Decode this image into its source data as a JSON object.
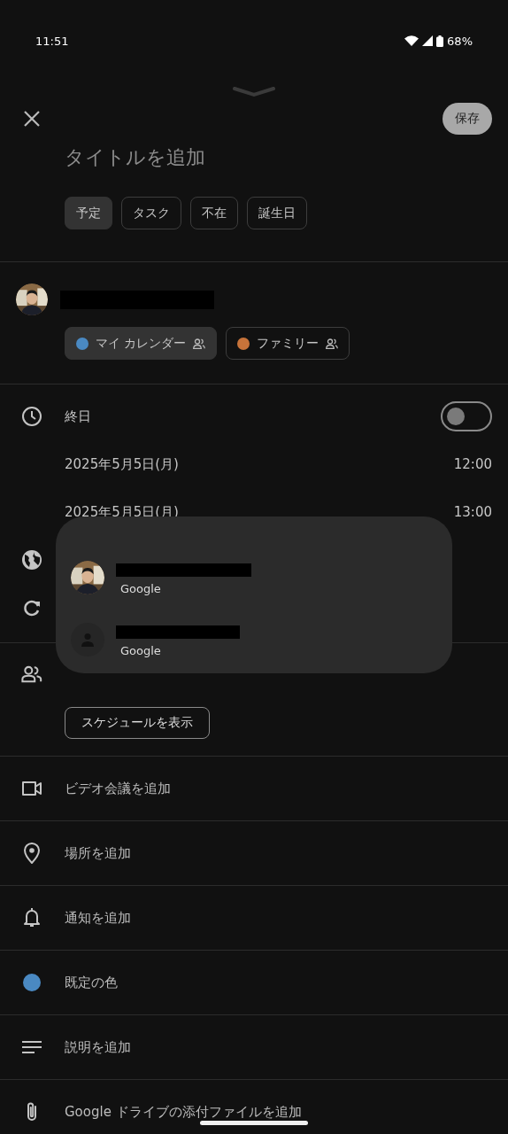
{
  "status_bar": {
    "time": "11:51",
    "battery": "68%"
  },
  "header": {
    "save": "保存"
  },
  "title": {
    "placeholder": "タイトルを追加"
  },
  "event_types": [
    {
      "label": "予定",
      "selected": true
    },
    {
      "label": "タスク",
      "selected": false
    },
    {
      "label": "不在",
      "selected": false
    },
    {
      "label": "誕生日",
      "selected": false
    }
  ],
  "calendars": [
    {
      "name": "マイ カレンダー",
      "color": "#4a89c2",
      "selected": true
    },
    {
      "name": "ファミリー",
      "color": "#c7733a",
      "selected": false
    }
  ],
  "all_day": {
    "label": "終日",
    "on": false
  },
  "start": {
    "date": "2025年5月5日(月)",
    "time": "12:00"
  },
  "end": {
    "date": "2025年5月5日(月)",
    "time": "13:00"
  },
  "guests": {
    "button": "スケジュールを表示"
  },
  "options": [
    {
      "kind": "video",
      "label": "ビデオ会議を追加"
    },
    {
      "kind": "location",
      "label": "場所を追加"
    },
    {
      "kind": "notification",
      "label": "通知を追加"
    },
    {
      "kind": "color",
      "label": "既定の色",
      "color": "#4a89c2"
    },
    {
      "kind": "description",
      "label": "説明を追加"
    },
    {
      "kind": "attachment",
      "label": "Google ドライブの添付ファイルを追加"
    }
  ],
  "account_menu": {
    "items": [
      {
        "provider": "Google"
      },
      {
        "kind": "default",
        "provider": "Google"
      }
    ]
  }
}
